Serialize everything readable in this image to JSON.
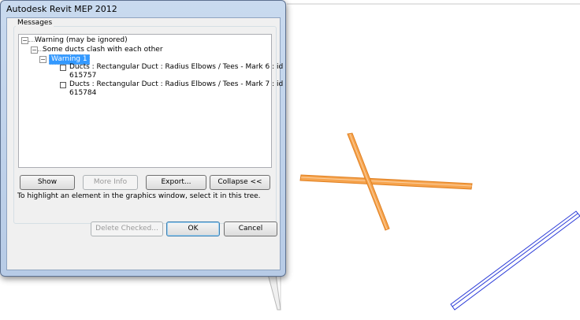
{
  "window": {
    "title": "Autodesk Revit MEP 2012"
  },
  "messages": {
    "label": "Messages",
    "tree": {
      "warning_group": "Warning (may be ignored)",
      "clash_group": "Some ducts clash with each other",
      "selected_item": "Warning 1",
      "elements": [
        {
          "line1": "Ducts : Rectangular Duct : Radius Elbows / Tees - Mark 6 : id",
          "line2": "615757"
        },
        {
          "line1": "Ducts : Rectangular Duct : Radius Elbows / Tees - Mark 7 : id",
          "line2": "615784"
        }
      ]
    }
  },
  "buttons": {
    "show": "Show",
    "more_info": "More Info",
    "export": "Export...",
    "collapse": "Collapse <<",
    "delete_checked": "Delete Checked...",
    "ok": "OK",
    "cancel": "Cancel"
  },
  "hint": "To highlight an element in the graphics window, select it in this tree.",
  "colors": {
    "duct_orange": "#f4a04a",
    "duct_blue": "#2b3bd8",
    "selection": "#3399ff"
  }
}
